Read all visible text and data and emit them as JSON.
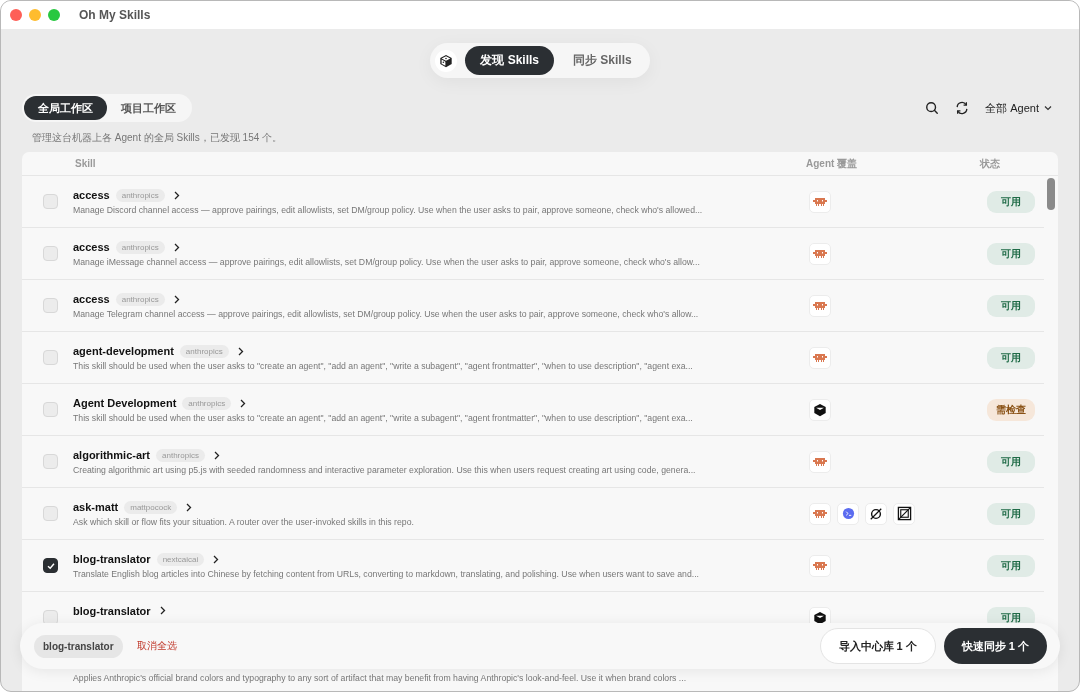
{
  "window": {
    "title": "Oh My Skills"
  },
  "top_tabs": [
    {
      "label": "发现 Skills",
      "selected": true
    },
    {
      "label": "同步 Skills",
      "selected": false
    }
  ],
  "scope_tabs": [
    {
      "label": "全局工作区",
      "selected": true
    },
    {
      "label": "项目工作区",
      "selected": false
    }
  ],
  "agent_filter": "全部 Agent",
  "summary": "管理这台机器上各 Agent 的全局 Skills，已发现 154 个。",
  "table": {
    "columns": [
      "Skill",
      "Agent 覆盖",
      "状态"
    ],
    "rows": [
      {
        "name": "access",
        "source": "anthropics",
        "description": "Manage Discord channel access — approve pairings, edit allowlists, set DM/group policy. Use when the user asks to pair, approve someone, check who's allowed...",
        "checked": false,
        "agents": [
          {
            "kind": "crab"
          }
        ],
        "status": {
          "label": "可用",
          "kind": "ok"
        }
      },
      {
        "name": "access",
        "source": "anthropics",
        "description": "Manage iMessage channel access — approve pairings, edit allowlists, set DM/group policy. Use when the user asks to pair, approve someone, check who's allow...",
        "checked": false,
        "agents": [
          {
            "kind": "crab"
          }
        ],
        "status": {
          "label": "可用",
          "kind": "ok"
        }
      },
      {
        "name": "access",
        "source": "anthropics",
        "description": "Manage Telegram channel access — approve pairings, edit allowlists, set DM/group policy. Use when the user asks to pair, approve someone, check who's allow...",
        "checked": false,
        "agents": [
          {
            "kind": "crab"
          }
        ],
        "status": {
          "label": "可用",
          "kind": "ok"
        }
      },
      {
        "name": "agent-development",
        "source": "anthropics",
        "description": "This skill should be used when the user asks to \"create an agent\", \"add an agent\", \"write a subagent\", \"agent frontmatter\", \"when to use description\", \"agent exa...",
        "checked": false,
        "agents": [
          {
            "kind": "crab"
          }
        ],
        "status": {
          "label": "可用",
          "kind": "ok"
        }
      },
      {
        "name": "Agent Development",
        "source": "anthropics",
        "description": "This skill should be used when the user asks to \"create an agent\", \"add an agent\", \"write a subagent\", \"agent frontmatter\", \"when to use description\", \"agent exa...",
        "checked": false,
        "agents": [
          {
            "kind": "cube"
          }
        ],
        "status": {
          "label": "需检查",
          "kind": "warn"
        }
      },
      {
        "name": "algorithmic-art",
        "source": "anthropics",
        "description": "Creating algorithmic art using p5.js with seeded randomness and interactive parameter exploration. Use this when users request creating art using code, genera...",
        "checked": false,
        "agents": [
          {
            "kind": "crab"
          }
        ],
        "status": {
          "label": "可用",
          "kind": "ok"
        }
      },
      {
        "name": "ask-matt",
        "source": "mattpocock",
        "description": "Ask which skill or flow fits your situation. A router over the user-invoked skills in this repo.",
        "checked": false,
        "agents": [
          {
            "kind": "crab"
          },
          {
            "kind": "terminal"
          },
          {
            "kind": "slash"
          },
          {
            "kind": "frame"
          }
        ],
        "status": {
          "label": "可用",
          "kind": "ok"
        }
      },
      {
        "name": "blog-translator",
        "source": "nextcaicai",
        "description": "Translate English blog articles into Chinese by fetching content from URLs, converting to markdown, translating, and polishing. Use when users want to save and...",
        "checked": true,
        "agents": [
          {
            "kind": "crab"
          }
        ],
        "status": {
          "label": "可用",
          "kind": "ok"
        }
      },
      {
        "name": "blog-translator",
        "checked": false,
        "agents": [
          {
            "kind": "cube"
          }
        ],
        "status": {
          "label": "可用",
          "kind": "ok"
        }
      },
      {
        "description": "Applies Anthropic's official brand colors and typography to any sort of artifact that may benefit from having Anthropic's look-and-feel. Use it when brand colors ...",
        "agents": []
      }
    ]
  },
  "selection_bar": {
    "chips": [
      "blog-translator"
    ],
    "clear_label": "取消全选",
    "import_button": "导入中心库 1 个",
    "sync_button": "快速同步 1 个"
  }
}
